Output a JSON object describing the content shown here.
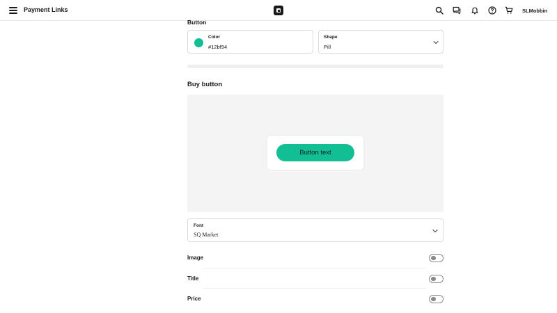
{
  "header": {
    "title": "Payment Links",
    "username": "SLMobbin",
    "icons": [
      "menu-icon",
      "square-logo-icon",
      "search-icon",
      "messages-icon",
      "bell-icon",
      "help-icon",
      "cart-icon"
    ]
  },
  "button_section": {
    "heading": "Button",
    "color": {
      "label": "Color",
      "value": "#12bf94"
    },
    "shape": {
      "label": "Shape",
      "value": "Pill"
    }
  },
  "buy_button_section": {
    "heading": "Buy button",
    "preview_button_text": "Button text",
    "preview_button_color": "#12bf94"
  },
  "font_field": {
    "label": "Font",
    "value": "SQ Market"
  },
  "toggles": [
    {
      "label": "Image",
      "on": false
    },
    {
      "label": "Title",
      "on": false
    },
    {
      "label": "Price",
      "on": false
    }
  ]
}
